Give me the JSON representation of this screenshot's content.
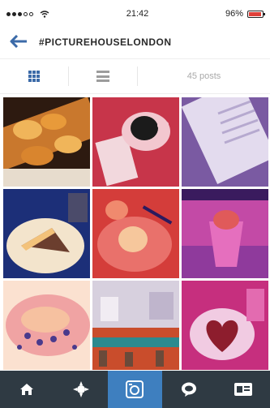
{
  "status_bar": {
    "carrier": "",
    "time": "21:42",
    "battery": "96%",
    "battery_level": 0.96
  },
  "header": {
    "title": "#PICTUREHOUSELONDON",
    "back_icon": "back-arrow-icon"
  },
  "view_bar": {
    "posts_label": "45 posts",
    "grid_icon": "grid-icon",
    "list_icon": "list-icon"
  },
  "photos": [
    {
      "subject": "pastries-on-wooden-board",
      "dominant_colors": [
        "#c9782d",
        "#2d1a10",
        "#f0b55a"
      ]
    },
    {
      "subject": "coffee-cup-on-red-table",
      "dominant_colors": [
        "#c7354a",
        "#f2d8dd",
        "#1b1b1b"
      ]
    },
    {
      "subject": "menu-card-purple",
      "dominant_colors": [
        "#b6a9cf",
        "#7a5aa2",
        "#e3dbee"
      ]
    },
    {
      "subject": "cake-slice-on-plate",
      "dominant_colors": [
        "#f3c27a",
        "#1c2f78",
        "#6b3e2e"
      ]
    },
    {
      "subject": "dessert-plate-red",
      "dominant_colors": [
        "#d43d3a",
        "#f6c79c",
        "#2c1a5e"
      ]
    },
    {
      "subject": "drink-in-glass-purple",
      "dominant_colors": [
        "#c34aa6",
        "#e05a5a",
        "#3a1b5e"
      ]
    },
    {
      "subject": "sandwich-on-board",
      "dominant_colors": [
        "#f0a3a3",
        "#4a3a8c",
        "#fbe1d0"
      ]
    },
    {
      "subject": "cinema-bar-interior",
      "dominant_colors": [
        "#d7d0de",
        "#2c8a8f",
        "#c94d2c"
      ]
    },
    {
      "subject": "heart-dessert-plate",
      "dominant_colors": [
        "#c62f7e",
        "#f1cbe2",
        "#8d1d2d"
      ]
    }
  ],
  "tab_bar": {
    "items": [
      {
        "name": "home",
        "icon": "home-icon",
        "active": false
      },
      {
        "name": "explore",
        "icon": "explore-icon",
        "active": false
      },
      {
        "name": "camera",
        "icon": "camera-icon",
        "active": true
      },
      {
        "name": "activity",
        "icon": "speech-bubble-icon",
        "active": false
      },
      {
        "name": "profile",
        "icon": "profile-card-icon",
        "active": false
      }
    ],
    "background": "#2f3a43",
    "active_color": "#3e7fbf"
  },
  "accent_color": "#3b6aa8"
}
